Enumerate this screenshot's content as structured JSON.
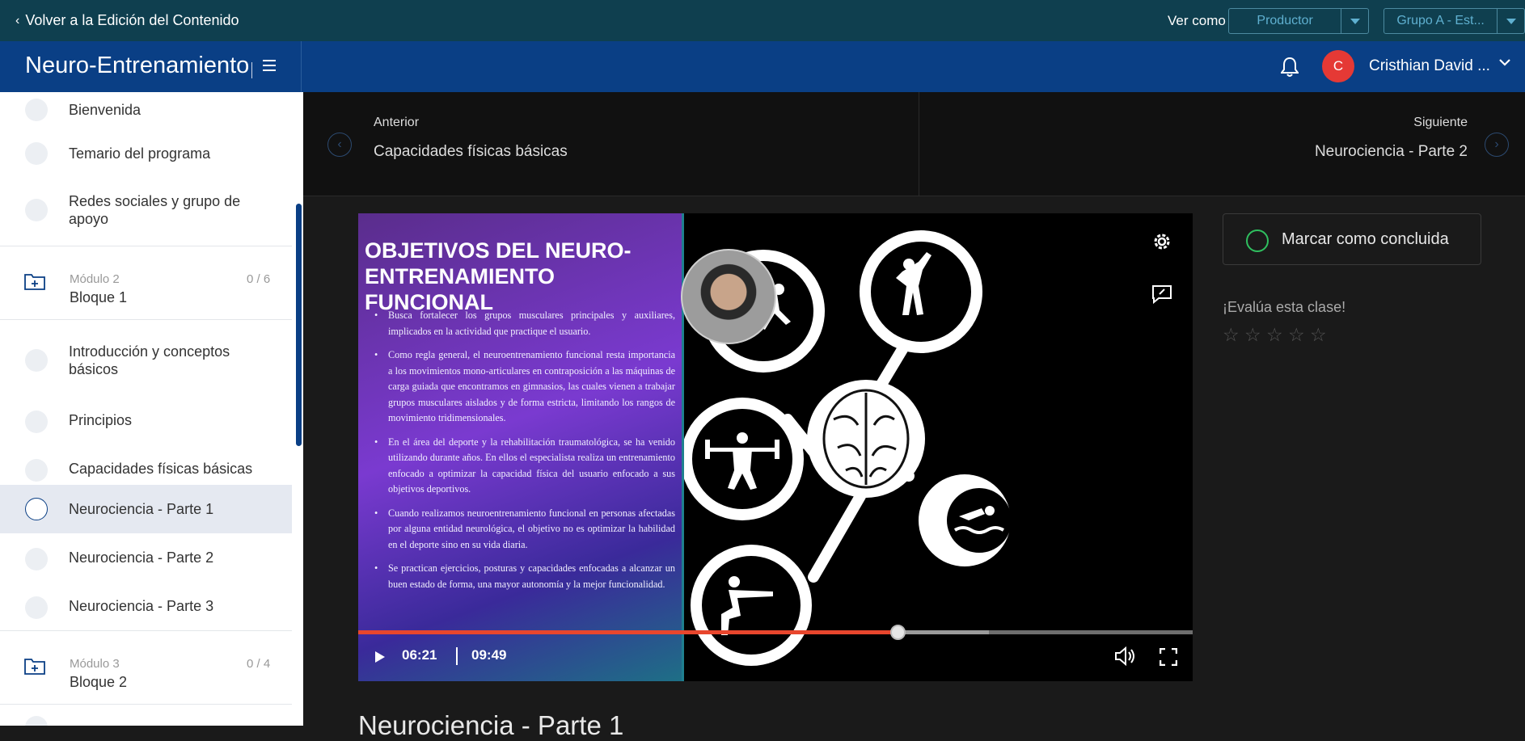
{
  "topbar": {
    "back_label": "Volver a la Edición del Contenido",
    "view_as_label": "Ver como",
    "role_select": "Productor",
    "group_select": "Grupo A - Est..."
  },
  "header": {
    "brand": "Neuro-Entrenamiento",
    "user_initial": "C",
    "user_name": "Cristhian David ..."
  },
  "sidebar": {
    "items_top": [
      {
        "label": "Bienvenida"
      },
      {
        "label": "Temario del programa"
      },
      {
        "label": "Redes sociales y grupo de apoyo"
      }
    ],
    "module2": {
      "label": "Módulo 2",
      "title": "Bloque 1",
      "count": "0 / 6"
    },
    "items_mid": [
      {
        "label": "Introducción y conceptos básicos"
      },
      {
        "label": "Principios"
      },
      {
        "label": "Capacidades físicas básicas"
      },
      {
        "label": "Neurociencia - Parte 1",
        "active": true
      },
      {
        "label": "Neurociencia - Parte 2"
      },
      {
        "label": "Neurociencia - Parte 3"
      }
    ],
    "module3": {
      "label": "Módulo 3",
      "title": "Bloque 2",
      "count": "0 / 4"
    }
  },
  "nav": {
    "prev_label": "Anterior",
    "prev_title": "Capacidades físicas básicas",
    "next_label": "Siguiente",
    "next_title": "Neurociencia - Parte 2"
  },
  "video": {
    "slide_title": "OBJETIVOS DEL NEURO-ENTRENAMIENTO FUNCIONAL",
    "bullets": [
      "Busca fortalecer los grupos musculares principales y auxiliares, implicados en la actividad que practique el usuario.",
      "Como regla general, el neuroentrenamiento funcional resta importancia a los movimientos mono-articulares en contraposición a las máquinas de carga guiada que encontramos en gimnasios, las cuales vienen a trabajar grupos musculares aislados y de forma estricta, limitando los rangos de movimiento tridimensionales.",
      "En el área del deporte y la rehabilitación traumatológica, se ha venido utilizando durante años. En ellos el especialista realiza un entrenamiento enfocado a optimizar la capacidad física del usuario enfocado a sus objetivos deportivos.",
      "Cuando realizamos neuroentrenamiento funcional en personas afectadas por alguna entidad neurológica, el objetivo no es optimizar la habilidad en el deporte sino en su vida diaria.",
      "Se practican ejercicios, posturas y capacidades enfocadas a alcanzar un buen estado de forma, una mayor autonomía y la mejor funcionalidad."
    ],
    "current_time": "06:21",
    "duration": "09:49",
    "progress_fraction": 0.647
  },
  "panel": {
    "complete_label": "Marcar como concluida",
    "rate_label": "¡Evalúa esta clase!",
    "rating_max": 5,
    "rating_value": 0
  },
  "lesson": {
    "title": "Neurociencia - Parte 1"
  },
  "colors": {
    "topbar": "#0f3f4f",
    "header": "#0a3f85",
    "progress": "#e8462d",
    "complete_ring": "#2fbf5f",
    "avatar": "#e53935"
  }
}
